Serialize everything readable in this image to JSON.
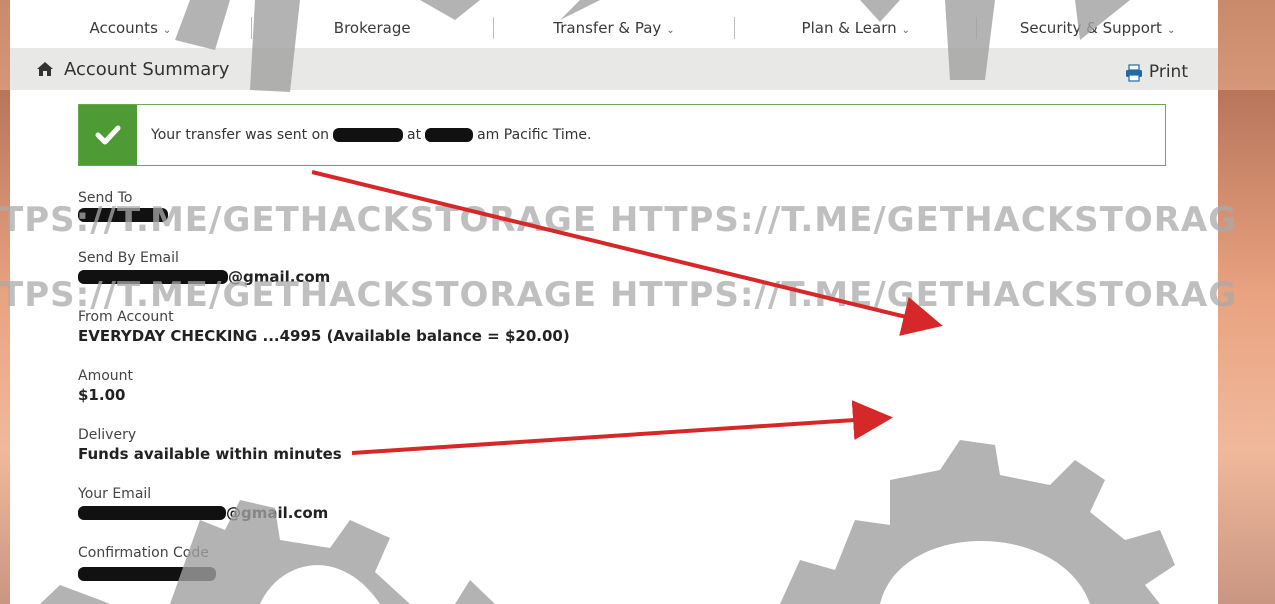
{
  "nav": {
    "items": [
      {
        "label": "Accounts",
        "has_dropdown": true
      },
      {
        "label": "Brokerage",
        "has_dropdown": false
      },
      {
        "label": "Transfer & Pay",
        "has_dropdown": true
      },
      {
        "label": "Plan & Learn",
        "has_dropdown": true
      },
      {
        "label": "Security & Support",
        "has_dropdown": true
      }
    ],
    "chevron": "⌄"
  },
  "subbar": {
    "title": "Account Summary",
    "print_label": "Print",
    "home_icon": "home-icon",
    "print_icon": "printer-icon"
  },
  "confirmation": {
    "part1": "Your transfer was sent on",
    "part2": "at",
    "part3": "am Pacific Time."
  },
  "fields": {
    "send_to": {
      "label": "Send To"
    },
    "send_by_email": {
      "label": "Send By Email",
      "suffix": "@gmail.com"
    },
    "from_account": {
      "label": "From Account",
      "value": "EVERYDAY CHECKING ...4995 (Available balance = $20.00)"
    },
    "amount": {
      "label": "Amount",
      "value": "$1.00"
    },
    "delivery": {
      "label": "Delivery",
      "value": "Funds available within minutes"
    },
    "your_email": {
      "label": "Your Email",
      "suffix": "@gmail.com"
    },
    "confirmation_code": {
      "label": "Confirmation Code"
    }
  },
  "watermark": {
    "line1": "TPS://T.ME/GETHACKSTORAGE   HTTPS://T.ME/GETHACKSTORAG",
    "line2": "TPS://T.ME/GETHACKSTORAGE   HTTPS://T.ME/GETHACKSTORAG"
  },
  "colors": {
    "success_green": "#4e9a35",
    "arrow_red": "#d62828",
    "print_blue": "#1e6aa8"
  }
}
